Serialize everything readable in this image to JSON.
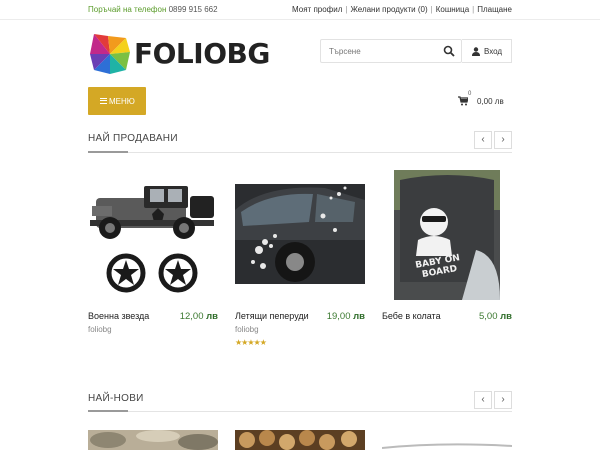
{
  "topbar": {
    "phone_label": "Поръчай на телефон",
    "phone_number": "0899 915 662",
    "links": [
      "Моят профил",
      "Желани продукти (0)",
      "Кошница",
      "Плащане"
    ]
  },
  "brand": {
    "name": "FOLIOBG"
  },
  "search": {
    "placeholder": "Търсене"
  },
  "login": {
    "label": "Вход"
  },
  "menu": {
    "label": "МЕНЮ"
  },
  "cart": {
    "count": "0",
    "total": "0,00 лв"
  },
  "bestsellers": {
    "title": "НАЙ ПРОДАВАНИ",
    "prev": "‹",
    "next": "›",
    "products": [
      {
        "name": "Военна звезда",
        "price": "12,00",
        "currency": "лв",
        "vendor": "foliobg",
        "rating": ""
      },
      {
        "name": "Летящи пеперуди",
        "price": "19,00",
        "currency": "лв",
        "vendor": "foliobg",
        "rating": "★★★★★"
      },
      {
        "name": "Бебе в колата",
        "price": "5,00",
        "currency": "лв",
        "vendor": "",
        "rating": ""
      }
    ]
  },
  "newest": {
    "title": "НАЙ-НОВИ",
    "prev": "‹",
    "next": "›"
  },
  "colors": {
    "accent": "#d4a825",
    "price": "#2f6d2a",
    "phone": "#5b9c2b"
  }
}
